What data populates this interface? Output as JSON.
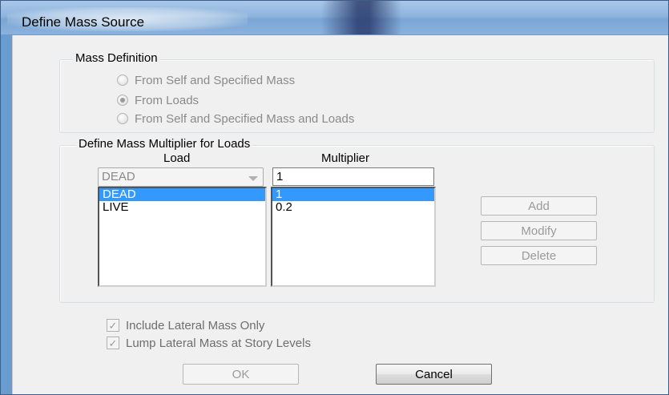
{
  "window": {
    "title": "Define Mass Source"
  },
  "mass_definition": {
    "group_title": "Mass Definition",
    "options": [
      {
        "label": "From Self and Specified Mass",
        "checked": false
      },
      {
        "label": "From Loads",
        "checked": true
      },
      {
        "label": "From Self and Specified Mass and Loads",
        "checked": false
      }
    ]
  },
  "multiplier": {
    "group_title": "Define Mass Multiplier for Loads",
    "load_header": "Load",
    "multiplier_header": "Multiplier",
    "load_combo_value": "DEAD",
    "multiplier_value": "1",
    "rows": [
      {
        "load": "DEAD",
        "multiplier": "1",
        "selected": true
      },
      {
        "load": "LIVE",
        "multiplier": "0.2",
        "selected": false
      }
    ],
    "buttons": {
      "add": "Add",
      "modify": "Modify",
      "delete": "Delete"
    }
  },
  "options": {
    "include_lateral": {
      "label": "Include Lateral Mass Only",
      "checked": true
    },
    "lump_lateral": {
      "label": "Lump Lateral Mass at Story Levels",
      "checked": true
    }
  },
  "footer": {
    "ok": "OK",
    "cancel": "Cancel"
  },
  "icons": {
    "radio": "radio-button-icon",
    "checkbox": "checkmark-icon",
    "dropdown": "chevron-down-icon"
  }
}
